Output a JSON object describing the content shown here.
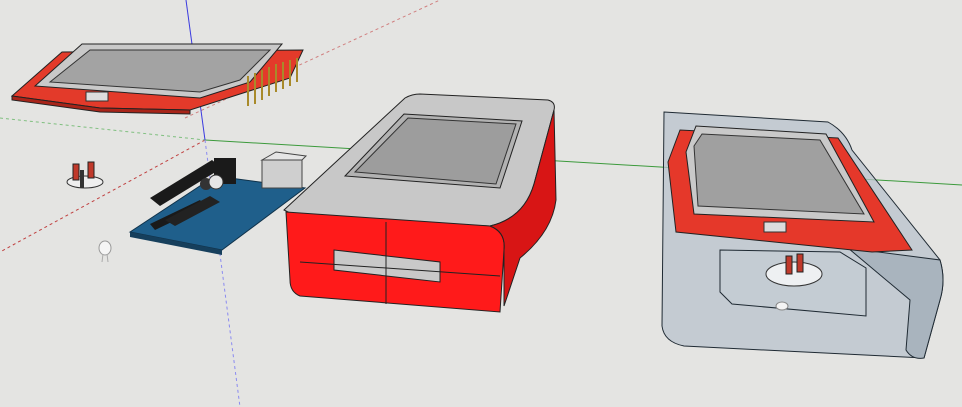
{
  "viewport": {
    "background_color": "#e4e4e2",
    "axis_colors": {
      "red": "#d05050",
      "green": "#3c9a3c",
      "blue": "#3a3ae0"
    }
  },
  "models": [
    {
      "name": "tft-display-shield",
      "color": "#e33a2a"
    },
    {
      "name": "arduino-board",
      "color": "#1f5f8b"
    },
    {
      "name": "red-enclosure",
      "color": "#ff1a1a"
    },
    {
      "name": "transparent-enclosure-with-display",
      "color": "#b9c3cc"
    },
    {
      "name": "push-button",
      "color": "#c0392b"
    },
    {
      "name": "led",
      "color": "#f2f2f2"
    }
  ]
}
